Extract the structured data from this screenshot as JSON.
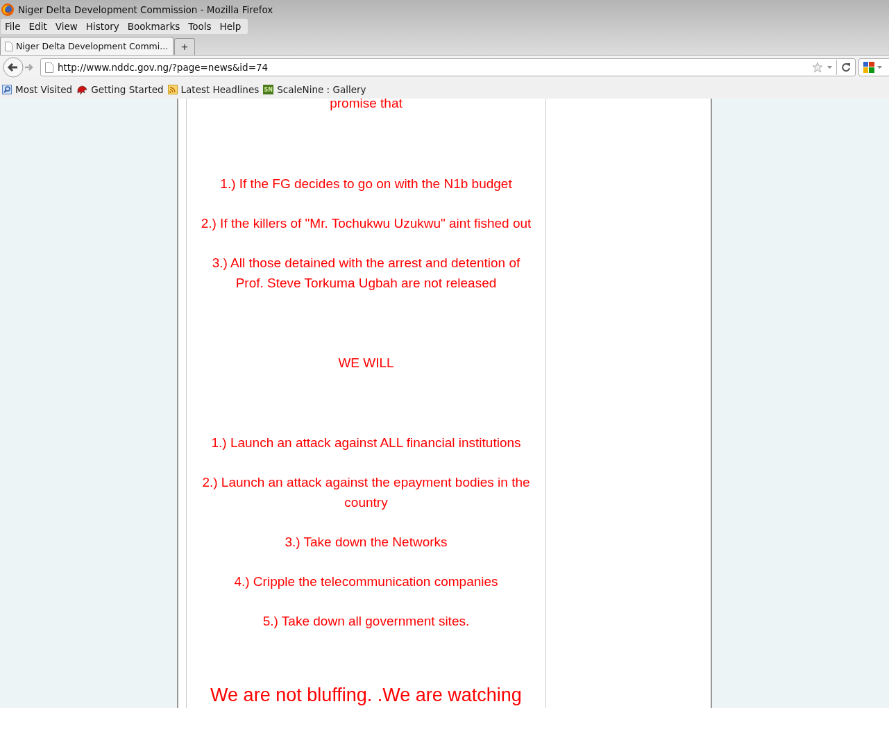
{
  "window": {
    "title": "Niger Delta Development Commission - Mozilla Firefox"
  },
  "menu": [
    "File",
    "Edit",
    "View",
    "History",
    "Bookmarks",
    "Tools",
    "Help"
  ],
  "tabs": [
    {
      "label": "Niger Delta Development Commi...",
      "selected": true
    }
  ],
  "new_tab": "+",
  "address": {
    "value": "http://www.nddc.gov.ng/?page=news&id=74"
  },
  "bookmarks": [
    {
      "label": "Most Visited",
      "kind": "folder"
    },
    {
      "label": "Getting Started",
      "kind": "dragon"
    },
    {
      "label": "Latest Headlines",
      "kind": "feed"
    },
    {
      "label": "ScaleNine : Gallery",
      "kind": "sn"
    }
  ],
  "bookmark_icon_text": "SN",
  "article": [
    {
      "kind": "intro",
      "text": "promise that"
    },
    {
      "kind": "item",
      "text": "1.) If the FG decides to go on with the N1b budget"
    },
    {
      "kind": "item",
      "text": "2.) If the killers of \"Mr. Tochukwu Uzukwu\" aint fished out"
    },
    {
      "kind": "item",
      "text": "3.) All those detained with the arrest and detention of Prof. Steve Torkuma Ugbah are not released"
    },
    {
      "kind": "heading",
      "text": "WE WILL"
    },
    {
      "kind": "item",
      "text": "1.) Launch an attack against ALL financial institutions"
    },
    {
      "kind": "item",
      "text": "2.) Launch an attack against the epayment bodies in the country"
    },
    {
      "kind": "item",
      "text": "3.) Take down the Networks"
    },
    {
      "kind": "item",
      "text": "4.) Cripple the telecommunication companies"
    },
    {
      "kind": "item",
      "text": "5.) Take down all government sites."
    },
    {
      "kind": "closing",
      "text": "We are not bluffing. .We are watching"
    }
  ]
}
